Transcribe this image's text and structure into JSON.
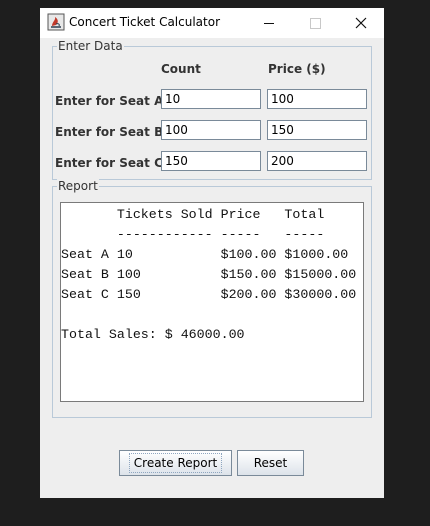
{
  "window": {
    "title": "Concert Ticket Calculator"
  },
  "enter_data": {
    "legend": "Enter Data",
    "col_count": "Count",
    "col_price": "Price ($)",
    "rows": [
      {
        "label": "Enter for Seat A:",
        "count": "10",
        "price": "100"
      },
      {
        "label": "Enter for Seat B:",
        "count": "100",
        "price": "150"
      },
      {
        "label": "Enter for Seat C:",
        "count": "150",
        "price": "200"
      }
    ]
  },
  "report": {
    "legend": "Report",
    "lines": [
      "       Tickets Sold Price   Total",
      "       ------------ -----   -----",
      "Seat A 10           $100.00 $1000.00",
      "Seat B 100          $150.00 $15000.00",
      "Seat C 150          $200.00 $30000.00",
      "",
      "Total Sales: $ 46000.00"
    ]
  },
  "buttons": {
    "create": "Create Report",
    "reset": "Reset"
  }
}
